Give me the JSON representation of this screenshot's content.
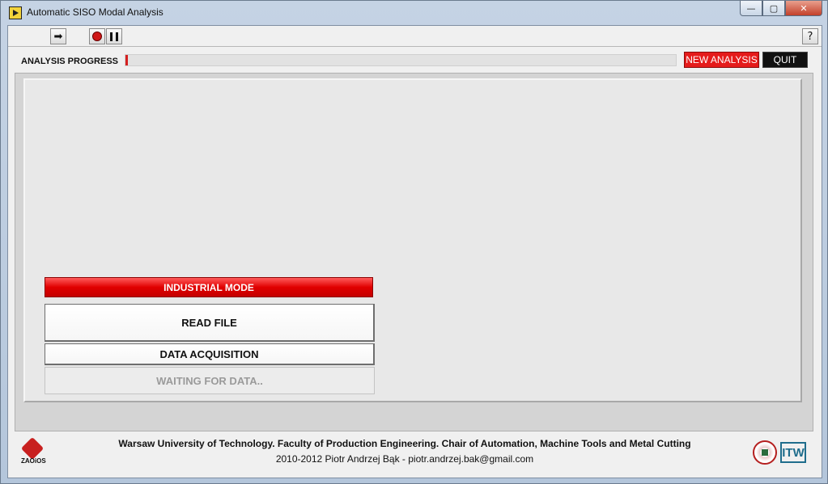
{
  "window": {
    "title": "Automatic SISO Modal Analysis",
    "controls": {
      "minimize": "—",
      "maximize": "▢",
      "close": "✕"
    }
  },
  "toolbar": {
    "run_icon": "run-arrow-icon",
    "abort_icon": "abort-stop-icon",
    "pause_icon": "pause-icon",
    "help_label": "?"
  },
  "progress": {
    "label": "ANALYSIS PROGRESS",
    "value_fraction": 0.005
  },
  "actions": {
    "new_analysis": "NEW ANALYSIS",
    "quit": "QUIT"
  },
  "panel": {
    "mode_label": "INDUSTRIAL MODE",
    "read_file": "READ FILE",
    "data_acquisition": "DATA ACQUISITION",
    "waiting_status": "WAITING FOR DATA.."
  },
  "footer": {
    "line1": "Warsaw University of Technology. Faculty of Production Engineering. Chair of Automation, Machine Tools and Metal Cutting",
    "line2": "2010-2012 Piotr Andrzej Bąk - piotr.andrzej.bak@gmail.com",
    "left_logo_text": "ZAOiOS",
    "right_logo_text": "ITW"
  },
  "colors": {
    "accent_red": "#e51b1b",
    "quit_black": "#111111"
  }
}
